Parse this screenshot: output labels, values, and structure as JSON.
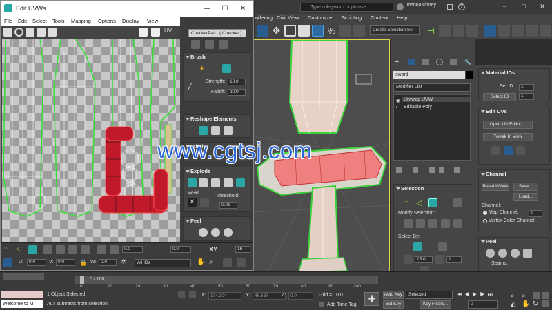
{
  "uv_editor": {
    "title": "Edit UVWs",
    "menu": [
      "File",
      "Edit",
      "Select",
      "Tools",
      "Mapping",
      "Options",
      "Display",
      "View"
    ],
    "uv_label": "UV",
    "checker_dropdown": "CheckerPatt...( Checker )",
    "brush": {
      "header": "Brush",
      "strength_label": "Strength:",
      "strength": "10.0",
      "falloff_label": "Falloff:",
      "falloff": "20.0"
    },
    "reshape": {
      "header": "Reshape Elements"
    },
    "stitch": {
      "header": "Stitch"
    },
    "explode": {
      "header": "Explode",
      "weld_label": "Weld",
      "threshold_label": "Threshold:",
      "threshold": "0.01"
    },
    "peel": {
      "header": "Peel"
    },
    "bottom_row1": {
      "value_a": "0.0",
      "value_b": "0.0",
      "xy_label": "XY",
      "value_c": "16"
    },
    "bottom_row2": {
      "u_label": "U:",
      "u_value": "0.0",
      "v_label": "V:",
      "v_value": "0.0",
      "w_label": "W:",
      "w_value": "0.0",
      "ids_dropdown": "All IDs"
    }
  },
  "max": {
    "search_placeholder": "Type a keyword or phrase",
    "user": "JoshuaKinney",
    "menu": [
      "ndering",
      "Civil View",
      "Customize",
      "Scripting",
      "Content",
      "Help"
    ],
    "selection_set": "Create Selection Se"
  },
  "command_panel": {
    "object_name": "sword",
    "modifier_list": "Modifier List",
    "stack": [
      "Unwrap UVW",
      "Editable Poly"
    ],
    "selection": {
      "header": "Selection",
      "modify_label": "Modify Selection:",
      "select_by": "Select By:",
      "spin1": "15.0",
      "spin2": "1"
    }
  },
  "params": {
    "material_ids": {
      "header": "Material IDs",
      "set_id_label": "Set ID:",
      "set_id": "1",
      "select_id_label": "Select ID",
      "select_id": "1"
    },
    "edit_uvs": {
      "header": "Edit UVs",
      "open_editor": "Open UV Editor ...",
      "tweak": "Tweak In View"
    },
    "channel": {
      "header": "Channel",
      "reset": "Reset UVWs",
      "save": "Save...",
      "load": "Load...",
      "channel_label": "Channel:",
      "map_channel_label": "Map Channel:",
      "map_channel": "1",
      "vertex_color": "Vertex Color Channel"
    },
    "peel": {
      "header": "Peel",
      "seams_label": "Seams:"
    }
  },
  "timeline": {
    "slider_text": "0 / 100",
    "ticks": [
      "0",
      "10",
      "20",
      "30",
      "40",
      "50",
      "60",
      "70",
      "80",
      "90",
      "100"
    ]
  },
  "status": {
    "maxscript": "Welcome to M",
    "selected": "1 Object Selected",
    "hint": "ALT subtracts from selection",
    "x_label": "X:",
    "x_value": "174.204",
    "y_label": "Y:",
    "y_value": "46.537",
    "z_label": "Z:",
    "z_value": "0.0",
    "grid": "Grid = 10.0",
    "add_time_tag": "Add Time Tag",
    "auto_key": "Auto Key",
    "set_key": "Set Key",
    "selected_dd": "Selected",
    "key_filters": "Key Filters...",
    "frame": "0"
  },
  "watermark": "www.cgtsj.com"
}
